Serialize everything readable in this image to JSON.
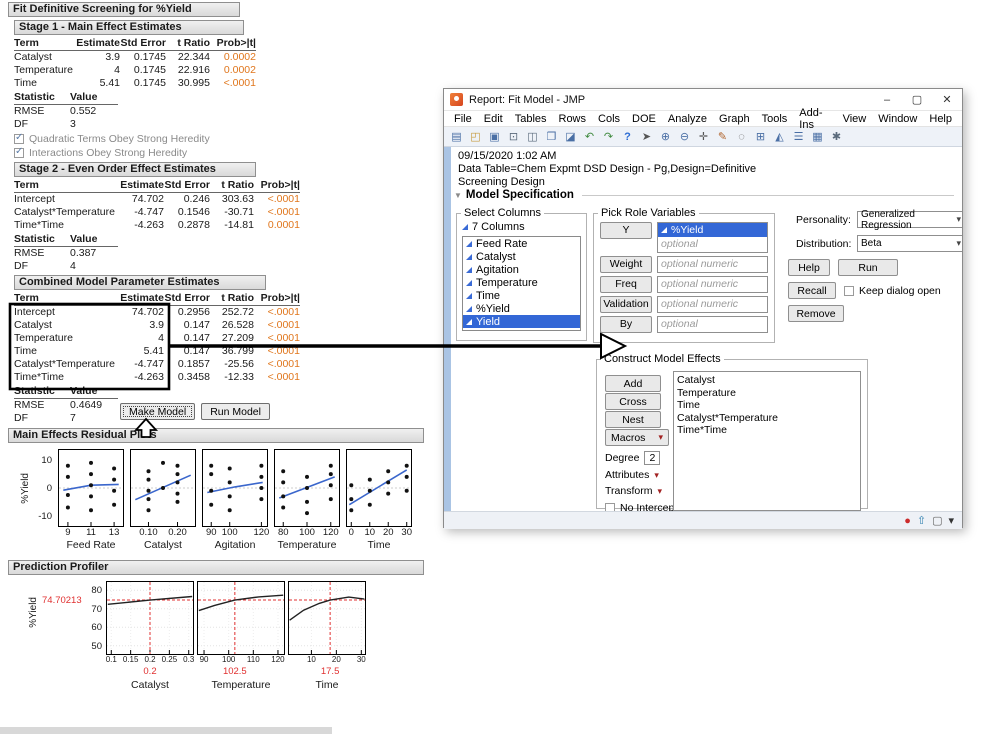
{
  "colors": {
    "selection_blue": "#3367d6",
    "pvalue_orange": "#e0761c",
    "residual_line_blue": "#3a66cc",
    "profiler_red": "#e03030",
    "continuous_icon_blue": "#3a6bd6"
  },
  "report": {
    "title": "Fit Definitive Screening for %Yield",
    "stage1": {
      "title": "Stage 1 - Main Effect Estimates",
      "columns": [
        "Term",
        "Estimate",
        "Std Error",
        "t Ratio",
        "Prob>|t|"
      ],
      "rows": [
        {
          "term": "Catalyst",
          "estimate": "3.9",
          "std_error": "0.1745",
          "t_ratio": "22.344",
          "prob": "0.0002"
        },
        {
          "term": "Temperature",
          "estimate": "4",
          "std_error": "0.1745",
          "t_ratio": "22.916",
          "prob": "0.0002"
        },
        {
          "term": "Time",
          "estimate": "5.41",
          "std_error": "0.1745",
          "t_ratio": "30.995",
          "prob": "<.0001"
        }
      ],
      "stat_columns": [
        "Statistic",
        "Value"
      ],
      "stats": [
        {
          "statistic": "RMSE",
          "value": "0.552"
        },
        {
          "statistic": "DF",
          "value": "3"
        }
      ],
      "checkboxes": [
        {
          "label": "Quadratic Terms Obey Strong Heredity"
        },
        {
          "label": "Interactions Obey Strong Heredity"
        }
      ]
    },
    "stage2": {
      "title": "Stage 2 - Even Order Effect Estimates",
      "columns": [
        "Term",
        "Estimate",
        "Std Error",
        "t Ratio",
        "Prob>|t|"
      ],
      "rows": [
        {
          "term": "Intercept",
          "estimate": "74.702",
          "std_error": "0.246",
          "t_ratio": "303.63",
          "prob": "<.0001"
        },
        {
          "term": "Catalyst*Temperature",
          "estimate": "-4.747",
          "std_error": "0.1546",
          "t_ratio": "-30.71",
          "prob": "<.0001"
        },
        {
          "term": "Time*Time",
          "estimate": "-4.263",
          "std_error": "0.2878",
          "t_ratio": "-14.81",
          "prob": "0.0001"
        }
      ],
      "stat_columns": [
        "Statistic",
        "Value"
      ],
      "stats": [
        {
          "statistic": "RMSE",
          "value": "0.387"
        },
        {
          "statistic": "DF",
          "value": "4"
        }
      ]
    },
    "combined": {
      "title": "Combined Model Parameter Estimates",
      "columns": [
        "Term",
        "Estimate",
        "Std Error",
        "t Ratio",
        "Prob>|t|"
      ],
      "rows": [
        {
          "term": "Intercept",
          "estimate": "74.702",
          "std_error": "0.2956",
          "t_ratio": "252.72",
          "prob": "<.0001"
        },
        {
          "term": "Catalyst",
          "estimate": "3.9",
          "std_error": "0.147",
          "t_ratio": "26.528",
          "prob": "<.0001"
        },
        {
          "term": "Temperature",
          "estimate": "4",
          "std_error": "0.147",
          "t_ratio": "27.209",
          "prob": "<.0001"
        },
        {
          "term": "Time",
          "estimate": "5.41",
          "std_error": "0.147",
          "t_ratio": "36.799",
          "prob": "<.0001"
        },
        {
          "term": "Catalyst*Temperature",
          "estimate": "-4.747",
          "std_error": "0.1857",
          "t_ratio": "-25.56",
          "prob": "<.0001"
        },
        {
          "term": "Time*Time",
          "estimate": "-4.263",
          "std_error": "0.3458",
          "t_ratio": "-12.33",
          "prob": "<.0001"
        }
      ],
      "stat_columns": [
        "Statistic",
        "Value"
      ],
      "stats": [
        {
          "statistic": "RMSE",
          "value": "0.4649"
        },
        {
          "statistic": "DF",
          "value": "7"
        }
      ],
      "make_model_label": "Make Model",
      "run_model_label": "Run Model"
    }
  },
  "chart_data": [
    {
      "type": "scatter",
      "title": "Main Effects Residual Plots",
      "ylabel": "%Yield",
      "ylim": [
        -14,
        14
      ],
      "yticks": [
        10,
        0,
        -10
      ],
      "legend": "none",
      "panels": [
        {
          "xlabel": "Feed Rate",
          "xticks": [
            "9",
            "11",
            "13"
          ],
          "tick_pos": [
            0.15,
            0.5,
            0.85
          ],
          "line": [
            [
              0.08,
              -0.8
            ],
            [
              0.5,
              1.0
            ],
            [
              0.92,
              1.3
            ]
          ],
          "points": [
            [
              0.15,
              -7
            ],
            [
              0.15,
              -2.5
            ],
            [
              0.15,
              4
            ],
            [
              0.15,
              8
            ],
            [
              0.5,
              -8
            ],
            [
              0.5,
              -3
            ],
            [
              0.5,
              1
            ],
            [
              0.5,
              5
            ],
            [
              0.5,
              9
            ],
            [
              0.85,
              -6
            ],
            [
              0.85,
              -1
            ],
            [
              0.85,
              3
            ],
            [
              0.85,
              7
            ]
          ]
        },
        {
          "xlabel": "Catalyst",
          "xticks": [
            "0.10",
            "0.20"
          ],
          "tick_pos": [
            0.28,
            0.72
          ],
          "line": [
            [
              0.08,
              -4.2
            ],
            [
              0.92,
              4.6
            ]
          ],
          "points": [
            [
              0.28,
              -8
            ],
            [
              0.28,
              -4
            ],
            [
              0.28,
              -1
            ],
            [
              0.28,
              3
            ],
            [
              0.28,
              6
            ],
            [
              0.5,
              0
            ],
            [
              0.5,
              9
            ],
            [
              0.72,
              -5
            ],
            [
              0.72,
              -2
            ],
            [
              0.72,
              2
            ],
            [
              0.72,
              5
            ],
            [
              0.72,
              8
            ]
          ]
        },
        {
          "xlabel": "Agitation",
          "xticks": [
            "90",
            "100",
            "120"
          ],
          "tick_pos": [
            0.14,
            0.42,
            0.9
          ],
          "line": [
            [
              0.08,
              -1.6
            ],
            [
              0.5,
              0.4
            ],
            [
              0.92,
              2.0
            ]
          ],
          "points": [
            [
              0.14,
              -6
            ],
            [
              0.14,
              -1
            ],
            [
              0.14,
              5
            ],
            [
              0.14,
              8
            ],
            [
              0.42,
              -8
            ],
            [
              0.42,
              -3
            ],
            [
              0.42,
              2
            ],
            [
              0.42,
              7
            ],
            [
              0.9,
              -4
            ],
            [
              0.9,
              0
            ],
            [
              0.9,
              4
            ],
            [
              0.9,
              8
            ]
          ]
        },
        {
          "xlabel": "Temperature",
          "xticks": [
            "80",
            "100",
            "120"
          ],
          "tick_pos": [
            0.14,
            0.5,
            0.86
          ],
          "line": [
            [
              0.08,
              -3.6
            ],
            [
              0.92,
              4.0
            ]
          ],
          "points": [
            [
              0.14,
              -7
            ],
            [
              0.14,
              -3
            ],
            [
              0.14,
              2
            ],
            [
              0.14,
              6
            ],
            [
              0.5,
              -9
            ],
            [
              0.5,
              -5
            ],
            [
              0.5,
              0
            ],
            [
              0.5,
              4
            ],
            [
              0.86,
              -4
            ],
            [
              0.86,
              1
            ],
            [
              0.86,
              5
            ],
            [
              0.86,
              8
            ]
          ]
        },
        {
          "xlabel": "Time",
          "xticks": [
            "0",
            "10",
            "20",
            "30"
          ],
          "tick_pos": [
            0.08,
            0.36,
            0.64,
            0.92
          ],
          "line": [
            [
              0.05,
              -6.0
            ],
            [
              0.92,
              6.5
            ]
          ],
          "points": [
            [
              0.08,
              -8
            ],
            [
              0.08,
              -4
            ],
            [
              0.08,
              1
            ],
            [
              0.36,
              -6
            ],
            [
              0.36,
              -1
            ],
            [
              0.36,
              3
            ],
            [
              0.64,
              -2
            ],
            [
              0.64,
              2
            ],
            [
              0.64,
              6
            ],
            [
              0.92,
              -1
            ],
            [
              0.92,
              4
            ],
            [
              0.92,
              8
            ]
          ]
        }
      ]
    },
    {
      "type": "line",
      "title": "Prediction Profiler",
      "ylabel": "%Yield",
      "ylim": [
        45,
        85
      ],
      "yticks": [
        80,
        70,
        60,
        50
      ],
      "current_y": 74.70213,
      "current_y_label": "74.70213",
      "panels": [
        {
          "xlabel": "Catalyst",
          "xticks": [
            "0.1",
            "0.15",
            "0.2",
            "0.25",
            "0.3"
          ],
          "tick_pos": [
            0.06,
            0.28,
            0.5,
            0.72,
            0.94
          ],
          "current_x": 0.5,
          "current_x_label": "0.2",
          "curve": [
            [
              0.02,
              72.4
            ],
            [
              0.5,
              74.7
            ],
            [
              0.98,
              76.6
            ]
          ]
        },
        {
          "xlabel": "Temperature",
          "xticks": [
            "90",
            "100",
            "110",
            "120"
          ],
          "tick_pos": [
            0.08,
            0.36,
            0.64,
            0.92
          ],
          "current_x": 0.43,
          "current_x_label": "102.5",
          "curve": [
            [
              0.02,
              69.0
            ],
            [
              0.2,
              71.8
            ],
            [
              0.43,
              74.7
            ],
            [
              0.7,
              76.4
            ],
            [
              0.98,
              77.3
            ]
          ]
        },
        {
          "xlabel": "Time",
          "xticks": [
            "10",
            "20",
            "30"
          ],
          "tick_pos": [
            0.3,
            0.62,
            0.94
          ],
          "current_x": 0.54,
          "current_x_label": "17.5",
          "curve": [
            [
              0.02,
              63.8
            ],
            [
              0.2,
              69.2
            ],
            [
              0.4,
              72.9
            ],
            [
              0.54,
              74.7
            ],
            [
              0.78,
              76.3
            ],
            [
              0.98,
              75.2
            ]
          ]
        }
      ]
    }
  ],
  "window": {
    "title": "Report: Fit Model - JMP",
    "controls": [
      {
        "name": "minimize-button",
        "glyph": "–"
      },
      {
        "name": "maximize-button",
        "glyph": "▢"
      },
      {
        "name": "close-button",
        "glyph": "✕"
      }
    ],
    "menus": [
      "File",
      "Edit",
      "Tables",
      "Rows",
      "Cols",
      "DOE",
      "Analyze",
      "Graph",
      "Tools",
      "Add-Ins",
      "View",
      "Window",
      "Help"
    ],
    "toolbar": [
      {
        "name": "new-file-icon",
        "glyph": "▤",
        "style": "color:#4a6fa5"
      },
      {
        "name": "open-folder-icon",
        "glyph": "◰",
        "style": "color:#c79a3b"
      },
      {
        "name": "save-icon",
        "glyph": "▣",
        "style": "color:#4a6fa5"
      },
      {
        "name": "print-icon",
        "glyph": "⊡",
        "style": "color:#5b6b7c"
      },
      {
        "name": "journal-icon",
        "glyph": "◫",
        "style": "color:#5b6b7c"
      },
      {
        "name": "copy-icon",
        "glyph": "❐",
        "style": "color:#4a6fa5"
      },
      {
        "name": "paste-icon",
        "glyph": "◪",
        "style": "color:#4a6fa5"
      },
      {
        "name": "undo-icon",
        "glyph": "↶",
        "style": "color:#3f8a3f"
      },
      {
        "name": "redo-icon",
        "glyph": "↷",
        "style": "color:#3f8a3f"
      },
      {
        "name": "help-icon",
        "glyph": "?",
        "style": "color:#2b6cd4;font-weight:bold"
      },
      {
        "name": "pointer-icon",
        "glyph": "➤",
        "style": "color:#555"
      },
      {
        "name": "zoom-in-icon",
        "glyph": "⊕",
        "style": "color:#4a6fa5"
      },
      {
        "name": "zoom-out-icon",
        "glyph": "⊖",
        "style": "color:#4a6fa5"
      },
      {
        "name": "crosshair-icon",
        "glyph": "✛",
        "style": "color:#555"
      },
      {
        "name": "brush-icon",
        "glyph": "✎",
        "style": "color:#b0632a"
      },
      {
        "name": "lasso-icon",
        "glyph": "◌",
        "style": "color:#555"
      },
      {
        "name": "table-icon",
        "glyph": "⊞",
        "style": "color:#4a6fa5"
      },
      {
        "name": "chart-icon",
        "glyph": "◭",
        "style": "color:#4a6fa5"
      },
      {
        "name": "list-icon",
        "glyph": "☰",
        "style": "color:#4a6fa5"
      },
      {
        "name": "layout-icon",
        "glyph": "▦",
        "style": "color:#4a6fa5"
      },
      {
        "name": "settings-icon",
        "glyph": "✱",
        "style": "color:#5b6b7c"
      }
    ],
    "timestamp": "09/15/2020 1:02 AM",
    "data_table_line": "Data Table=Chem Expmt DSD Design - Pg,Design=Definitive",
    "data_table_line2": "Screening Design",
    "disclosure_glyph": "▼",
    "caret_glyph": "▾",
    "model_spec": {
      "title": "Model Specification",
      "select_columns": {
        "label": "Select Columns",
        "count_label": "7 Columns",
        "items": [
          "Feed Rate",
          "Catalyst",
          "Agitation",
          "Temperature",
          "Time",
          "%Yield",
          "Yield"
        ],
        "selected": "Yield"
      },
      "pick_roles": {
        "label": "Pick Role Variables",
        "y_button": "Y",
        "y_value": "%Yield",
        "y_placeholder": "optional",
        "rows": [
          {
            "button": "Weight",
            "placeholder": "optional numeric"
          },
          {
            "button": "Freq",
            "placeholder": "optional numeric"
          },
          {
            "button": "Validation",
            "placeholder": "optional numeric"
          },
          {
            "button": "By",
            "placeholder": "optional"
          }
        ]
      },
      "personality_label": "Personality:",
      "personality_value": "Generalized Regression",
      "distribution_label": "Distribution:",
      "distribution_value": "Beta",
      "help_label": "Help",
      "run_label": "Run",
      "recall_label": "Recall",
      "remove_label": "Remove",
      "keep_dialog_label": "Keep dialog open",
      "construct": {
        "label": "Construct Model Effects",
        "add_label": "Add",
        "cross_label": "Cross",
        "nest_label": "Nest",
        "macros_label": "Macros",
        "degree_label": "Degree",
        "degree_value": "2",
        "attributes_label": "Attributes",
        "transform_label": "Transform",
        "no_intercept_label": "No Intercept",
        "effects": [
          "Catalyst",
          "Temperature",
          "Time",
          "Catalyst*Temperature",
          "Time*Time"
        ]
      }
    },
    "status_icons": [
      {
        "name": "error-status-icon",
        "glyph": "●",
        "style": "color:#cc2b2b"
      },
      {
        "name": "update-arrow-icon",
        "glyph": "⇧",
        "style": "color:#2e7fae"
      },
      {
        "name": "window-box-icon",
        "glyph": "▢",
        "style": "color:#666"
      },
      {
        "name": "caret-down-icon",
        "glyph": "▾",
        "style": "color:#333"
      }
    ]
  }
}
